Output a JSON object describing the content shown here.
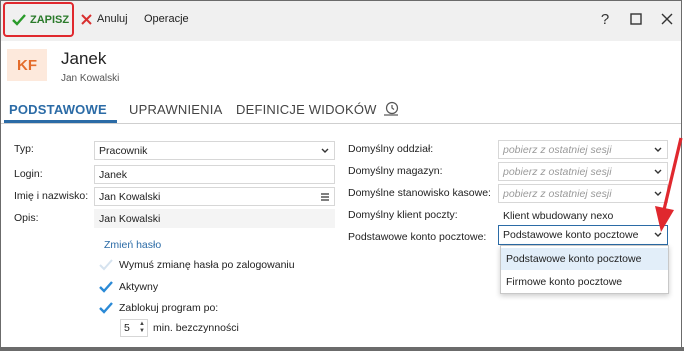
{
  "toolbar": {
    "save_label": "ZAPISZ",
    "cancel_label": "Anuluj",
    "operations_label": "Operacje",
    "help_label": "?"
  },
  "header": {
    "initials": "KF",
    "name": "Janek",
    "full_name": "Jan Kowalski"
  },
  "tabs": [
    {
      "label": "PODSTAWOWE",
      "active": true
    },
    {
      "label": "UPRAWNIENIA",
      "active": false
    },
    {
      "label": "DEFINICJE WIDOKÓW",
      "active": false
    }
  ],
  "left_form": {
    "type_label": "Typ:",
    "type_value": "Pracownik",
    "login_label": "Login:",
    "login_value": "Janek",
    "fullname_label": "Imię i nazwisko:",
    "fullname_value": "Jan Kowalski",
    "desc_label": "Opis:",
    "desc_value": "Jan Kowalski",
    "change_password": "Zmień hasło",
    "force_change": {
      "label": "Wymuś zmianę hasła po zalogowaniu",
      "checked": false
    },
    "active": {
      "label": "Aktywny",
      "checked": true
    },
    "lock": {
      "label": "Zablokuj program po:",
      "checked": true
    },
    "idle_minutes": "5",
    "idle_suffix": "min. bezczynności"
  },
  "right_form": {
    "branch_label": "Domyślny oddział:",
    "branch_placeholder": "pobierz z ostatniej sesji",
    "warehouse_label": "Domyślny magazyn:",
    "warehouse_placeholder": "pobierz z ostatniej sesji",
    "station_label": "Domyślne stanowisko kasowe:",
    "station_placeholder": "pobierz z ostatniej sesji",
    "mail_client_label": "Domyślny klient poczty:",
    "mail_client_value": "Klient wbudowany nexo",
    "mail_account_label": "Podstawowe konto pocztowe:",
    "mail_account_value": "Podstawowe konto pocztowe"
  },
  "dropdown_options": [
    {
      "label": "Podstawowe konto pocztowe",
      "selected": true
    },
    {
      "label": "Firmowe konto pocztowe",
      "selected": false
    }
  ],
  "colors": {
    "accent": "#2b6ba6",
    "save_green": "#2a7a2a",
    "highlight_red": "#e0282e",
    "avatar_bg": "#fde9dc",
    "avatar_fg": "#e46c2b"
  }
}
